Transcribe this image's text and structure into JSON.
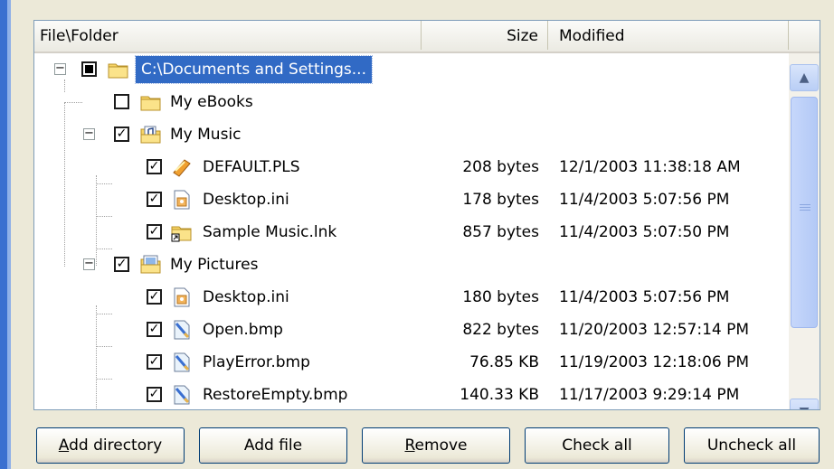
{
  "columns": {
    "name": "File\\Folder",
    "size": "Size",
    "modified": "Modified"
  },
  "rows": [
    {
      "label": "C:\\Documents and Settings...",
      "size": "",
      "modified": "",
      "check": "partial",
      "icon": "folder-icon",
      "expander": "⊟"
    },
    {
      "label": "My eBooks",
      "size": "",
      "modified": "",
      "check": "unchecked",
      "icon": "folder-icon"
    },
    {
      "label": "My Music",
      "size": "",
      "modified": "",
      "check": "checked",
      "icon": "music-folder-icon",
      "expander": "⊟"
    },
    {
      "label": "DEFAULT.PLS",
      "size": "208 bytes",
      "modified": "12/1/2003 11:38:18 AM",
      "check": "checked",
      "icon": "playlist-file-icon"
    },
    {
      "label": "Desktop.ini",
      "size": "178 bytes",
      "modified": "11/4/2003 5:07:56 PM",
      "check": "checked",
      "icon": "settings-file-icon"
    },
    {
      "label": "Sample Music.lnk",
      "size": "857 bytes",
      "modified": "11/4/2003 5:07:50 PM",
      "check": "checked",
      "icon": "shortcut-folder-icon"
    },
    {
      "label": "My Pictures",
      "size": "",
      "modified": "",
      "check": "checked",
      "icon": "pictures-folder-icon",
      "expander": "⊟"
    },
    {
      "label": "Desktop.ini",
      "size": "180 bytes",
      "modified": "11/4/2003 5:07:56 PM",
      "check": "checked",
      "icon": "settings-file-icon"
    },
    {
      "label": "Open.bmp",
      "size": "822 bytes",
      "modified": "11/20/2003 12:57:14 PM",
      "check": "checked",
      "icon": "bitmap-file-icon"
    },
    {
      "label": "PlayError.bmp",
      "size": "76.85 KB",
      "modified": "11/19/2003 12:18:06 PM",
      "check": "checked",
      "icon": "bitmap-file-icon"
    },
    {
      "label": "RestoreEmpty.bmp",
      "size": "140.33 KB",
      "modified": "11/17/2003 9:29:14 PM",
      "check": "checked",
      "icon": "bitmap-file-icon"
    }
  ],
  "buttons": {
    "add_directory": {
      "access_key": "A",
      "rest": "dd directory"
    },
    "add_file_a": "Add f",
    "add_file_key": "i",
    "add_file_b": "le",
    "remove": {
      "access_key": "R",
      "rest": "emove"
    },
    "check_all": "Check all",
    "uncheck_all": "Uncheck all"
  },
  "colors": {
    "selection": "#316ac5",
    "window": "#ece9d8",
    "accent": "#3a6fd0"
  }
}
